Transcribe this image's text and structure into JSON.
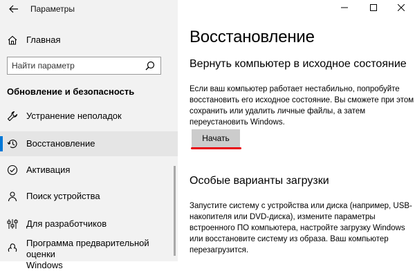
{
  "window": {
    "title": "Параметры",
    "controls": [
      "minimize-icon",
      "maximize-icon",
      "close-icon"
    ]
  },
  "sidebar": {
    "home_label": "Главная",
    "search_placeholder": "Найти параметр",
    "section_title": "Обновление и безопасность",
    "items": [
      {
        "label": "Устранение неполадок",
        "icon": "wrench-icon",
        "active": false
      },
      {
        "label": "Восстановление",
        "icon": "history-icon",
        "active": true
      },
      {
        "label": "Активация",
        "icon": "check-circle-icon",
        "active": false
      },
      {
        "label": "Поиск устройства",
        "icon": "person-icon",
        "active": false
      },
      {
        "label": "Для разработчиков",
        "icon": "sliders-icon",
        "active": false
      },
      {
        "label": "Программа предварительной оценки",
        "label2": "Windows",
        "icon": "insider-icon",
        "active": false
      }
    ]
  },
  "main": {
    "title": "Восстановление",
    "reset_section": {
      "title": "Вернуть компьютер в исходное состояние",
      "lines": [
        "Если ваш компьютер работает нестабильно, попробуйте",
        "восстановить его исходное состояние. Вы сможете при этом",
        "сохранить или удалить личные файлы, а затем",
        "переустановить Windows."
      ],
      "button_label": "Начать"
    },
    "boot_section": {
      "title": "Особые варианты загрузки",
      "lines": [
        "Запустите систему с устройства или диска (например, USB-",
        "накопителя или DVD-диска), измените параметры",
        "встроенного ПО компьютера, настройте загрузку Windows",
        "или восстановите систему из образа. Ваш компьютер",
        "перезагрузится."
      ]
    }
  },
  "colors": {
    "accent": "#0078d7",
    "annotation_underline": "#e8000a",
    "sidebar_bg": "#f2f2f2",
    "button_bg": "#cccccc"
  }
}
